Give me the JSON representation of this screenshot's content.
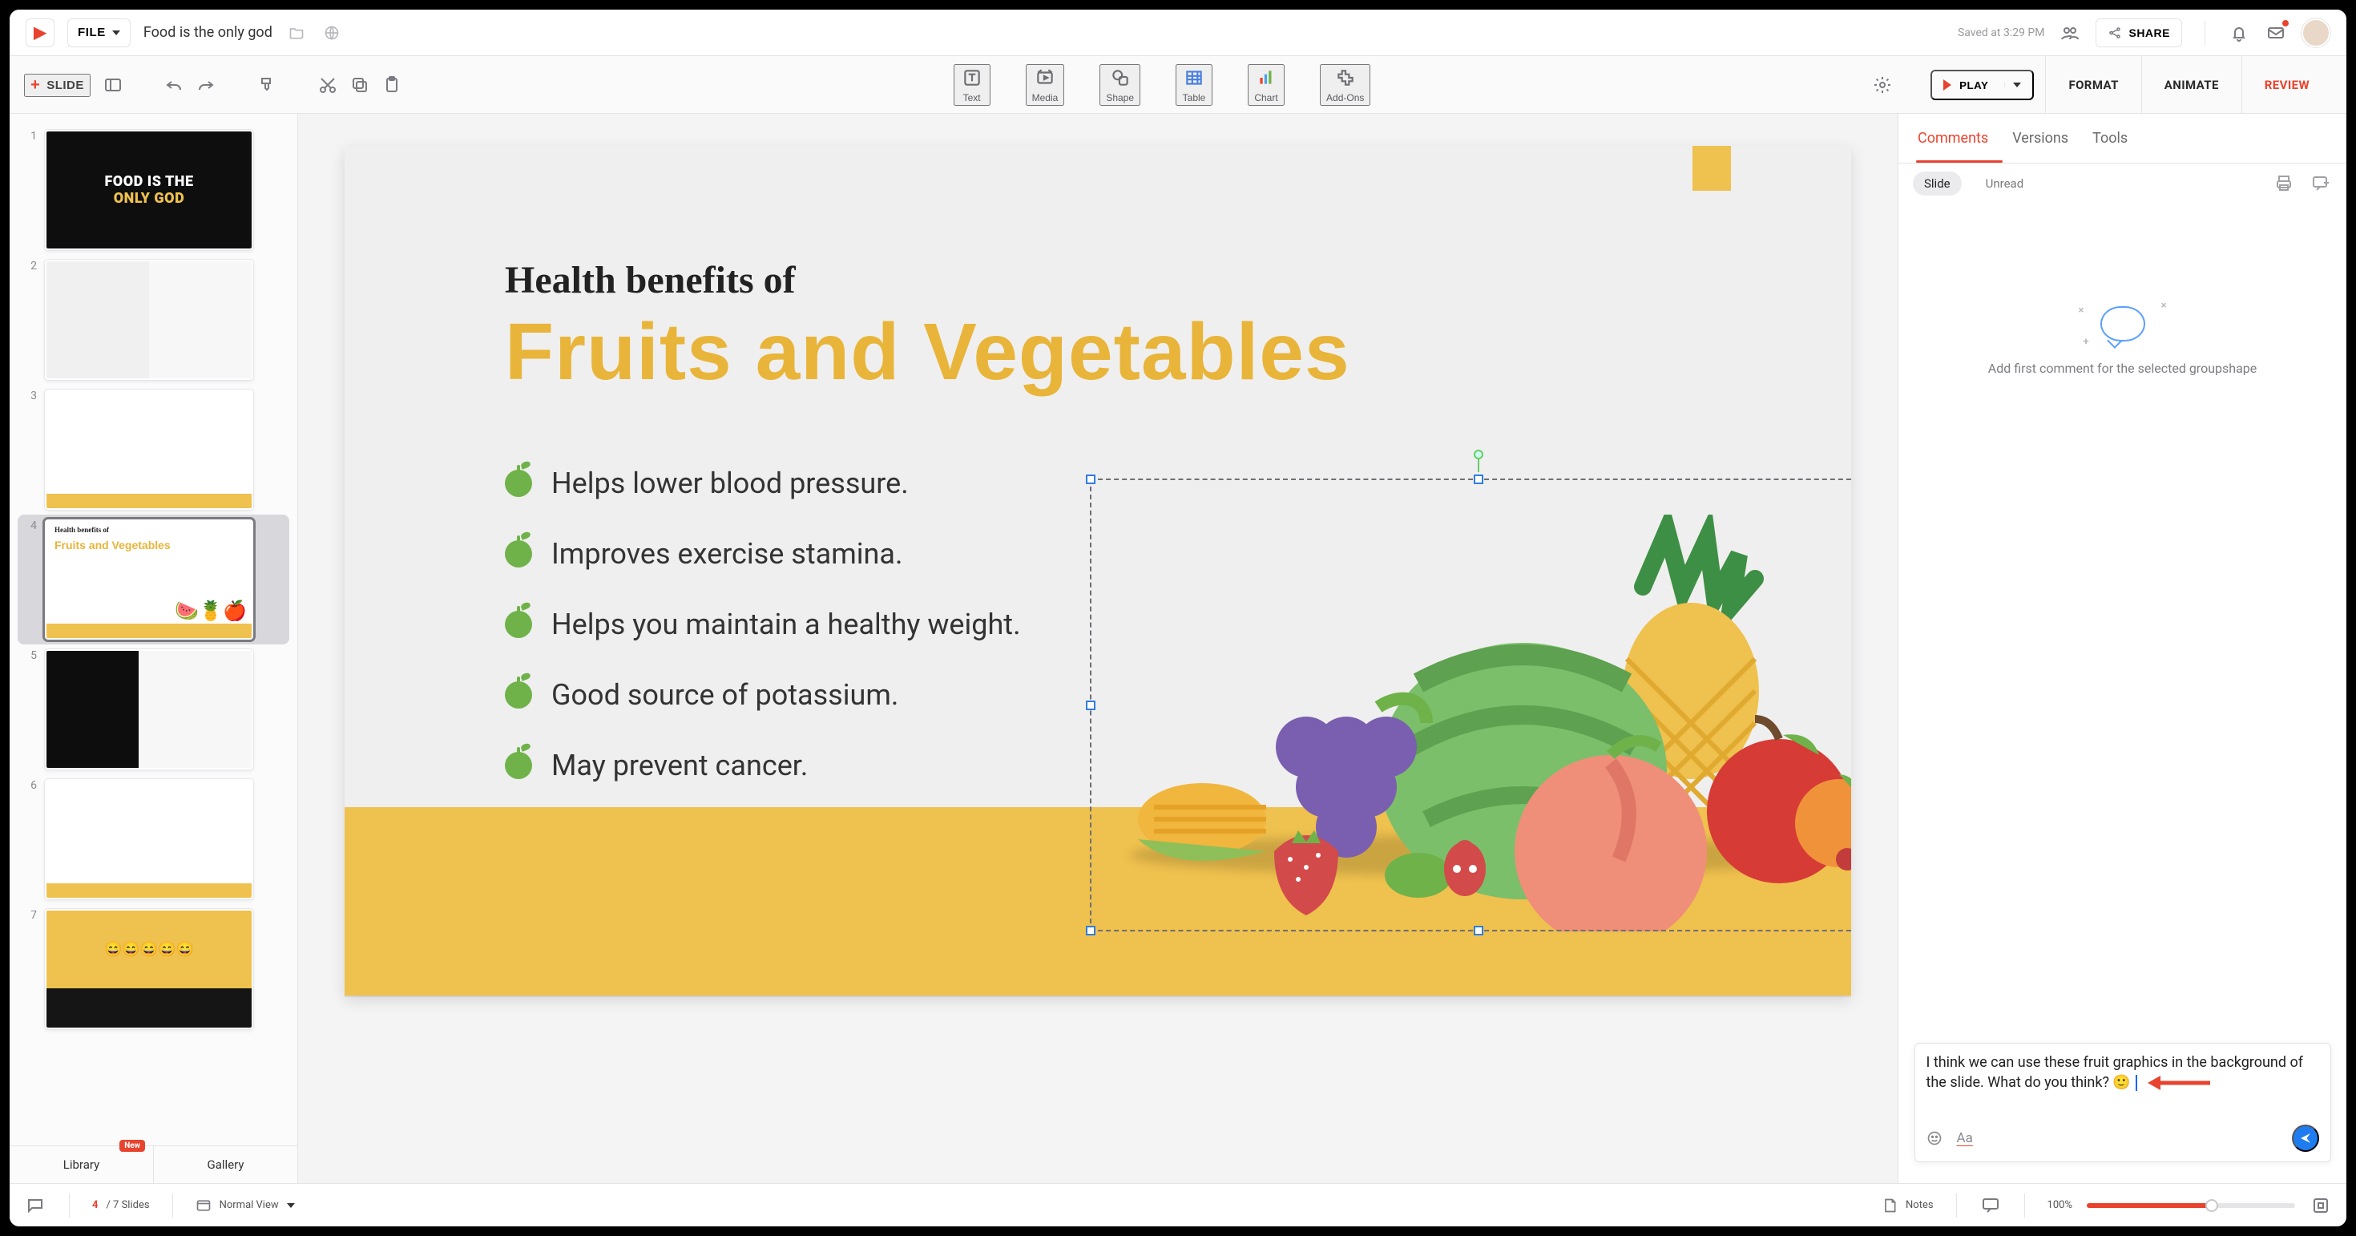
{
  "topbar": {
    "file_label": "FILE",
    "document_title": "Food is the only god",
    "saved_text": "Saved at 3:29 PM",
    "share_label": "SHARE"
  },
  "secondbar": {
    "new_slide_label": "SLIDE",
    "tools": {
      "text": "Text",
      "media": "Media",
      "shape": "Shape",
      "table": "Table",
      "chart": "Chart",
      "addons": "Add-Ons"
    },
    "play_label": "PLAY",
    "tabs": {
      "format": "FORMAT",
      "animate": "ANIMATE",
      "review": "REVIEW"
    }
  },
  "thumbnails": {
    "items": [
      {
        "num": "1",
        "kind": "hero",
        "l1": "FOOD IS THE",
        "l2": "ONLY GOD"
      },
      {
        "num": "2",
        "kind": "split",
        "caption": ""
      },
      {
        "num": "3",
        "kind": "amberBottom",
        "caption": ""
      },
      {
        "num": "4",
        "kind": "current",
        "caption": "Health benefits of\\nFruits and Vegetables"
      },
      {
        "num": "5",
        "kind": "splitDark",
        "caption": ""
      },
      {
        "num": "6",
        "kind": "amberBottom",
        "caption": ""
      },
      {
        "num": "7",
        "kind": "emoji",
        "caption": ""
      }
    ],
    "lib_tabs": {
      "library": "Library",
      "gallery": "Gallery",
      "new_badge": "New"
    }
  },
  "slide": {
    "h_small": "Health benefits of",
    "h_big": "Fruits and Vegetables",
    "bullets": [
      "Helps lower blood pressure.",
      "Improves exercise stamina.",
      "Helps you maintain a healthy weight.",
      "Good source of potassium.",
      "May prevent cancer."
    ]
  },
  "review_panel": {
    "subtabs": {
      "comments": "Comments",
      "versions": "Versions",
      "tools": "Tools"
    },
    "filter": {
      "slide": "Slide",
      "unread": "Unread"
    },
    "empty_hint": "Add first comment for the selected groupshape",
    "composer_text": "I think we can use these fruit graphics in the background of the slide. What do you think? 🙂",
    "aa": "Aa"
  },
  "statusbar": {
    "current_slide": "4",
    "total_slides_label": "/ 7 Slides",
    "view_label": "Normal View",
    "notes_label": "Notes",
    "zoom_label": "100%"
  },
  "colors": {
    "accent_red": "#e8432e",
    "accent_amber": "#efc14e"
  }
}
